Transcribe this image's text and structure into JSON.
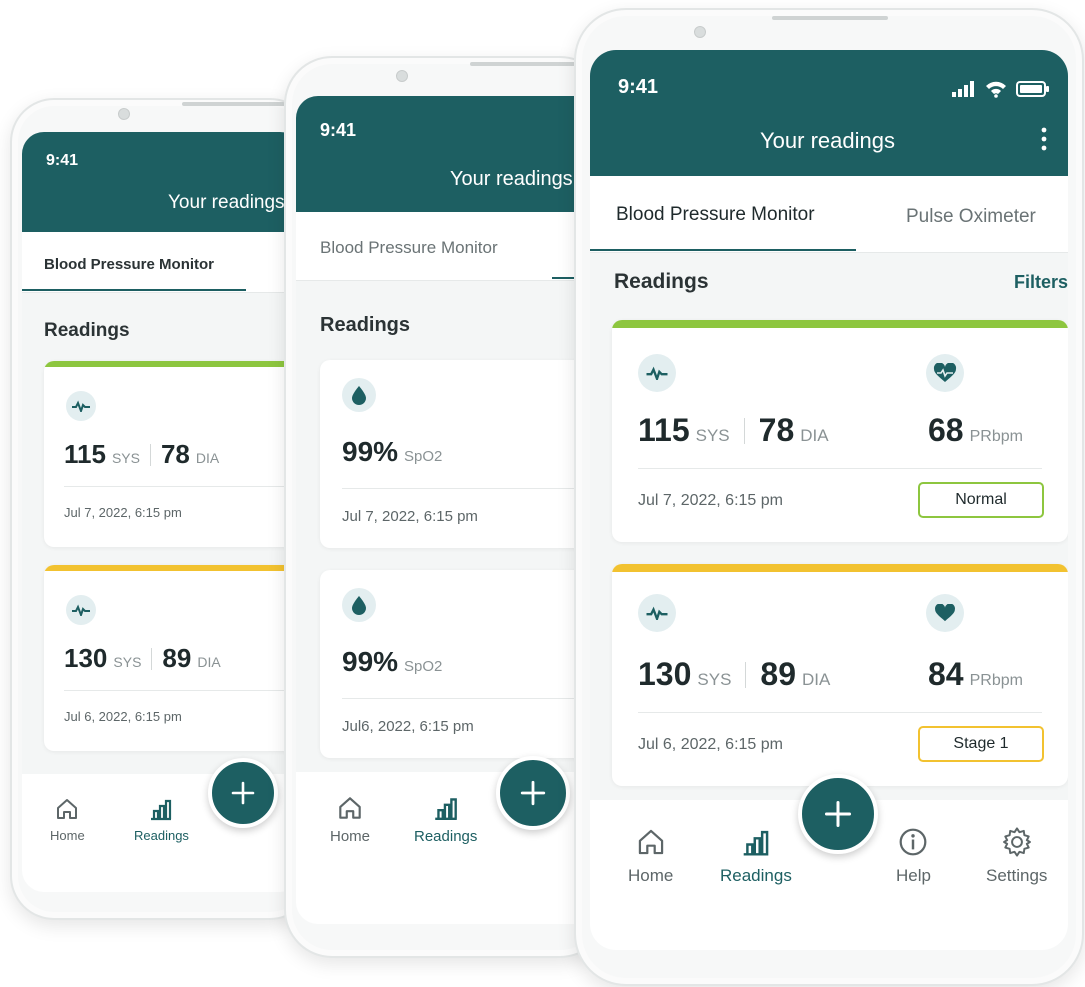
{
  "colors": {
    "brand": "#1d5f62",
    "status_normal": "#8dc63f",
    "status_stage1": "#f2c230"
  },
  "status_bar": {
    "time": "9:41"
  },
  "header": {
    "title": "Your readings",
    "menu_icon": "more-vertical-icon"
  },
  "tabs": [
    {
      "label": "Blood Pressure Monitor",
      "active": true
    },
    {
      "label": "Pulse Oximeter",
      "active": false
    }
  ],
  "readings": {
    "section_title": "Readings",
    "filters_label": "Filters"
  },
  "bp_readings": [
    {
      "sys": "115",
      "sys_unit": "SYS",
      "dia": "78",
      "dia_unit": "DIA",
      "pulse": "68",
      "pulse_unit": "PRbpm",
      "date": "Jul 7, 2022, 6:15 pm",
      "status": "Normal"
    },
    {
      "sys": "130",
      "sys_unit": "SYS",
      "dia": "89",
      "dia_unit": "DIA",
      "pulse": "84",
      "pulse_unit": "PRbpm",
      "date": "Jul 6, 2022, 6:15 pm",
      "status": "Stage 1"
    }
  ],
  "spo2_readings": [
    {
      "value": "99%",
      "unit": "SpO2",
      "date": "Jul 7, 2022, 6:15 pm"
    },
    {
      "value": "99%",
      "unit": "SpO2",
      "date": "Jul6, 2022, 6:15 pm"
    }
  ],
  "nav": {
    "home": "Home",
    "readings": "Readings",
    "help": "Help",
    "settings": "Settings"
  }
}
